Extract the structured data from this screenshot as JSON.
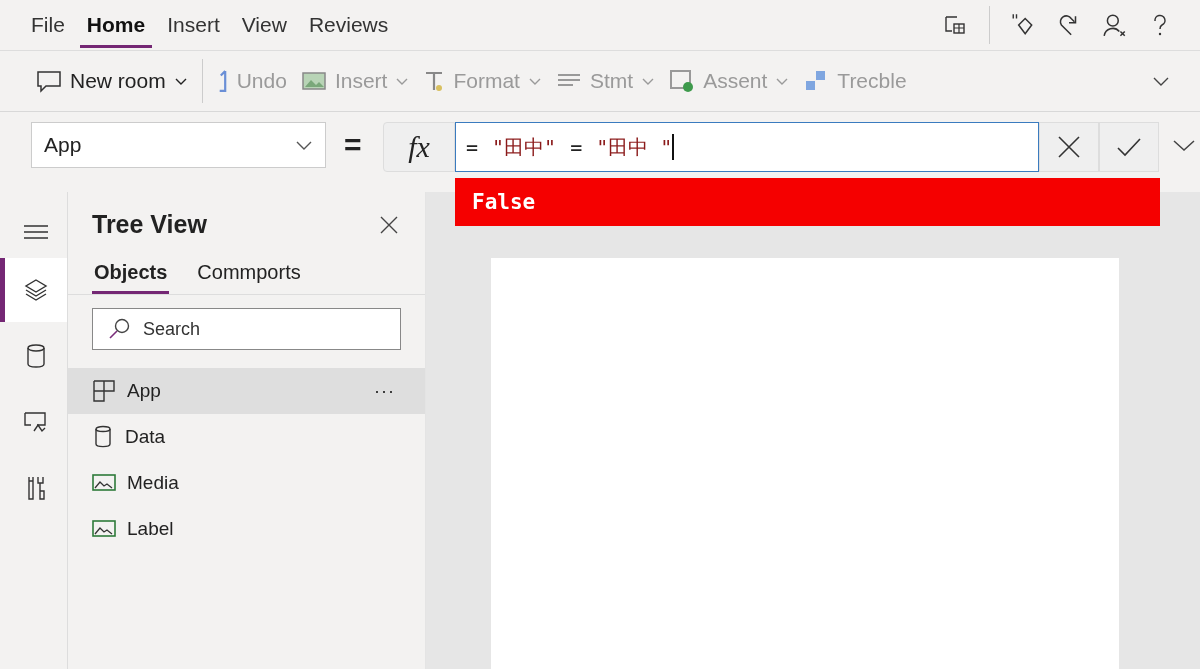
{
  "menu_tabs": [
    {
      "label": "File",
      "selected": false
    },
    {
      "label": "Home",
      "selected": true
    },
    {
      "label": "Insert",
      "selected": false
    },
    {
      "label": "View",
      "selected": false
    },
    {
      "label": "Reviews",
      "selected": false
    }
  ],
  "toolbar": [
    {
      "kind": "comment",
      "label": "New room",
      "dropdown": true,
      "disabled": false
    },
    {
      "kind": "undo",
      "label": "Undo",
      "dropdown": false,
      "disabled": true
    },
    {
      "kind": "image",
      "label": "Insert",
      "dropdown": true,
      "disabled": true
    },
    {
      "kind": "text",
      "label": "Format",
      "dropdown": true,
      "disabled": true
    },
    {
      "kind": "lines",
      "label": "Stmt",
      "dropdown": true,
      "disabled": true
    },
    {
      "kind": "media",
      "label": "Assent",
      "dropdown": true,
      "disabled": true
    },
    {
      "kind": "blocks",
      "label": "Trecble",
      "dropdown": false,
      "disabled": true
    }
  ],
  "property_dropdown": {
    "value": "App"
  },
  "formula_bar": {
    "equals": "=",
    "fx": "fx",
    "tokens": [
      {
        "kind": "operator",
        "text": "="
      },
      {
        "kind": "string",
        "text": "\"田中\""
      },
      {
        "kind": "operator",
        "text": "="
      },
      {
        "kind": "string",
        "text": "\"田中 \""
      }
    ],
    "result": "False"
  },
  "rail": [
    {
      "kind": "menu",
      "selected": false
    },
    {
      "kind": "layers",
      "selected": true
    },
    {
      "kind": "data",
      "selected": false
    },
    {
      "kind": "media",
      "selected": false
    },
    {
      "kind": "tools",
      "selected": false
    }
  ],
  "tree_view": {
    "title": "Tree View",
    "tabs": [
      {
        "label": "Objects",
        "selected": true
      },
      {
        "label": "Commports",
        "selected": false
      }
    ],
    "search": {
      "placeholder": "Search"
    },
    "items": [
      {
        "kind": "screen",
        "label": "App",
        "selected": true,
        "more": "···"
      },
      {
        "kind": "data",
        "label": "Data",
        "selected": false
      },
      {
        "kind": "image",
        "label": "Media",
        "selected": false
      },
      {
        "kind": "image",
        "label": "Label",
        "selected": false
      }
    ]
  }
}
